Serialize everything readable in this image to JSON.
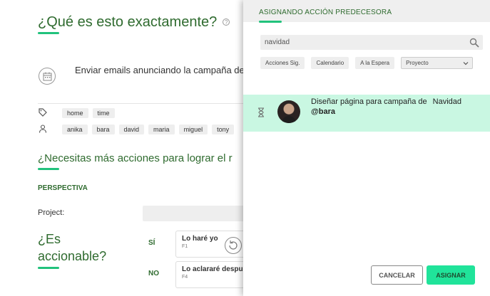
{
  "background": {
    "title": "¿Qué es esto exactamente?",
    "task_text": "Enviar emails anunciando la campaña de",
    "tags": [
      "home",
      "time"
    ],
    "users": [
      "anika",
      "bara",
      "david",
      "maria",
      "miguel",
      "tony"
    ],
    "section_title": "¿Necesitas más acciones para lograr el r",
    "perspective_label": "PERSPECTIVA",
    "project_label": "Project:",
    "actionable_title_line1": "¿Es",
    "actionable_title_line2": "accionable?",
    "yes_label": "SÍ",
    "no_label": "NO",
    "option_yes_title": "Lo haré yo",
    "option_yes_key": "F1",
    "option_no_title": "Lo aclararé despu",
    "option_no_key": "F4"
  },
  "panel": {
    "title": "ASIGNANDO ACCIÓN PREDECESORA",
    "search_value": "navidad",
    "filters": [
      "Acciones Sig.",
      "Calendario",
      "A la Espera"
    ],
    "project_select": "Proyecto",
    "result": {
      "title": "Diseñar página para campaña de",
      "title_suffix": "Navidad",
      "user": "@bara",
      "status_icon": "hourglass-icon"
    },
    "cancel_label": "CANCELAR",
    "assign_label": "ASIGNAR"
  },
  "colors": {
    "brand_green": "#2f6b2f",
    "accent": "#21c27c",
    "selected_row": "#c9f7e2",
    "assign_button": "#20e39a"
  }
}
